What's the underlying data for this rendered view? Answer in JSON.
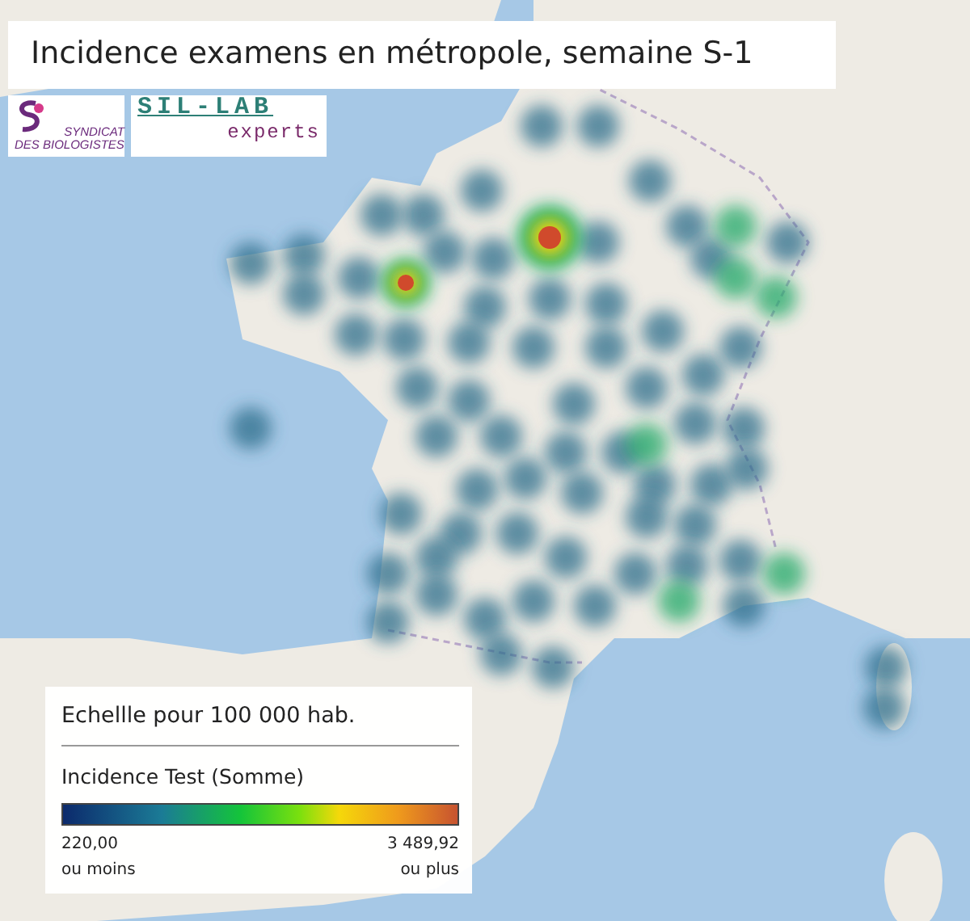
{
  "title": "Incidence examens en métropole, semaine S-1",
  "logos": [
    {
      "kind": "syndicat",
      "lines": [
        "SYNDICAT",
        "DES BIOLOGISTES"
      ]
    },
    {
      "kind": "sillab",
      "name": "SIL-LAB",
      "tagline": "experts"
    }
  ],
  "legend": {
    "title": "Echellle pour 100 000 hab.",
    "measure": "Incidence Test (Somme)",
    "min_value": "220,00",
    "min_note": "ou moins",
    "max_value": "3 489,92",
    "max_note": "ou plus"
  }
}
